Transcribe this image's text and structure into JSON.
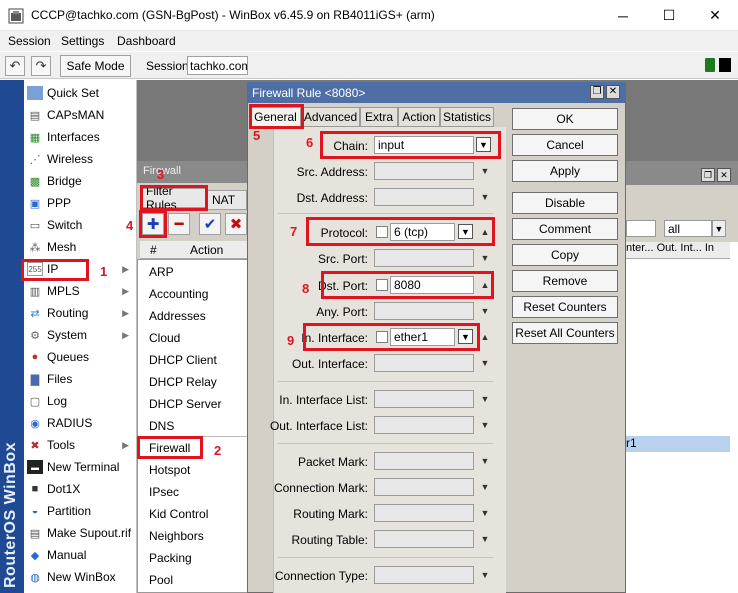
{
  "window": {
    "title": "CCCP@tachko.com (GSN-BgPost) - WinBox v6.45.9 on RB4011iGS+ (arm)",
    "controls": {
      "minimize": "─",
      "maximize": "☐",
      "close": "✕"
    }
  },
  "menubar": [
    "Session",
    "Settings",
    "Dashboard"
  ],
  "toolbar": {
    "undo_icon": "↶",
    "redo_icon": "↷",
    "safe_mode": "Safe Mode",
    "session_label": "Session:",
    "session_value": "tachko.com"
  },
  "sidebar": {
    "brand": "RouterOS WinBox",
    "items": [
      {
        "label": "Quick Set",
        "icon": "quick-set-icon"
      },
      {
        "label": "CAPsMAN",
        "icon": "capsman-icon"
      },
      {
        "label": "Interfaces",
        "icon": "interfaces-icon"
      },
      {
        "label": "Wireless",
        "icon": "wireless-icon"
      },
      {
        "label": "Bridge",
        "icon": "bridge-icon"
      },
      {
        "label": "PPP",
        "icon": "ppp-icon"
      },
      {
        "label": "Switch",
        "icon": "switch-icon"
      },
      {
        "label": "Mesh",
        "icon": "mesh-icon"
      },
      {
        "label": "IP",
        "icon": "ip-icon",
        "has_submenu": true
      },
      {
        "label": "MPLS",
        "icon": "mpls-icon",
        "has_submenu": true
      },
      {
        "label": "Routing",
        "icon": "routing-icon",
        "has_submenu": true
      },
      {
        "label": "System",
        "icon": "system-icon",
        "has_submenu": true
      },
      {
        "label": "Queues",
        "icon": "queues-icon"
      },
      {
        "label": "Files",
        "icon": "files-icon"
      },
      {
        "label": "Log",
        "icon": "log-icon"
      },
      {
        "label": "RADIUS",
        "icon": "radius-icon"
      },
      {
        "label": "Tools",
        "icon": "tools-icon",
        "has_submenu": true
      },
      {
        "label": "New Terminal",
        "icon": "terminal-icon"
      },
      {
        "label": "Dot1X",
        "icon": "dot1x-icon"
      },
      {
        "label": "Partition",
        "icon": "partition-icon"
      },
      {
        "label": "Make Supout.rif",
        "icon": "supout-icon"
      },
      {
        "label": "Manual",
        "icon": "manual-icon"
      },
      {
        "label": "New WinBox",
        "icon": "new-winbox-icon"
      }
    ]
  },
  "ip_submenu": [
    "ARP",
    "Accounting",
    "Addresses",
    "Cloud",
    "DHCP Client",
    "DHCP Relay",
    "DHCP Server",
    "DNS",
    "Firewall",
    "Hotspot",
    "IPsec",
    "Kid Control",
    "Neighbors",
    "Packing",
    "Pool"
  ],
  "firewall_window": {
    "title": "Firewall",
    "tabs": [
      "Filter Rules",
      "NAT"
    ],
    "tools": {
      "add": "✚",
      "remove": "━",
      "enable": "✔",
      "disable": "✖"
    },
    "columns": [
      "#",
      "Action"
    ],
    "right_columns": "nter... Out. Int... In",
    "filter_value": "all",
    "selected_row_text": "r1",
    "controls": {
      "restore": "❐",
      "close": "✕"
    }
  },
  "rule_dialog": {
    "title": "Firewall Rule <8080>",
    "controls": {
      "restore": "❐",
      "close": "✕"
    },
    "tabs": [
      "General",
      "Advanced",
      "Extra",
      "Action",
      "Statistics"
    ],
    "fields": {
      "chain": {
        "label": "Chain:",
        "value": "input"
      },
      "src_address": {
        "label": "Src. Address:"
      },
      "dst_address": {
        "label": "Dst. Address:"
      },
      "protocol": {
        "label": "Protocol:",
        "value": "6 (tcp)"
      },
      "src_port": {
        "label": "Src. Port:"
      },
      "dst_port": {
        "label": "Dst. Port:",
        "value": "8080"
      },
      "any_port": {
        "label": "Any. Port:"
      },
      "in_interface": {
        "label": "In. Interface:",
        "value": "ether1"
      },
      "out_interface": {
        "label": "Out. Interface:"
      },
      "in_interface_list": {
        "label": "In. Interface List:"
      },
      "out_interface_list": {
        "label": "Out. Interface List:"
      },
      "packet_mark": {
        "label": "Packet Mark:"
      },
      "connection_mark": {
        "label": "Connection Mark:"
      },
      "routing_mark": {
        "label": "Routing Mark:"
      },
      "routing_table": {
        "label": "Routing Table:"
      },
      "connection_type": {
        "label": "Connection Type:"
      }
    },
    "buttons": [
      "OK",
      "Cancel",
      "Apply",
      "Disable",
      "Comment",
      "Copy",
      "Remove",
      "Reset Counters",
      "Reset All Counters"
    ]
  },
  "annotations": [
    "1",
    "2",
    "3",
    "4",
    "5",
    "6",
    "7",
    "8",
    "9"
  ],
  "colors": {
    "annotation": "#e0141e",
    "brand_blue": "#1f4a93",
    "dialog_title": "#4e6fa6"
  }
}
